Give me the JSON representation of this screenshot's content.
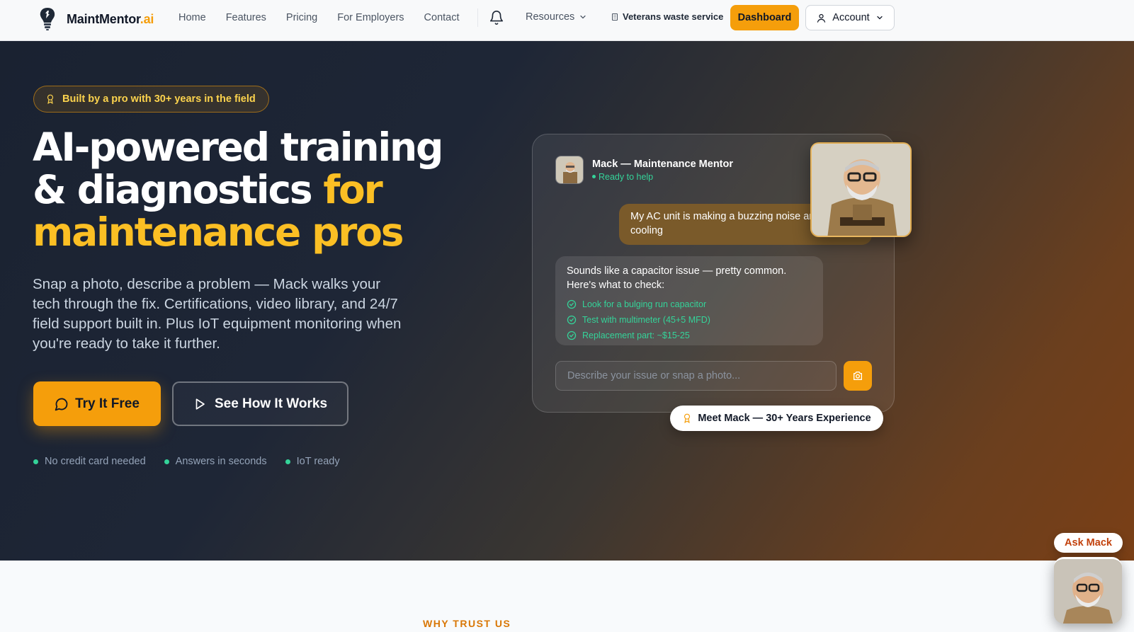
{
  "nav": {
    "brand_main": "MaintMentor",
    "brand_accent": ".ai",
    "links": [
      "Home",
      "Features",
      "Pricing",
      "For Employers",
      "Contact"
    ],
    "notification_icon": "bell-icon",
    "resources_label": "Resources",
    "veterans_label": "Veterans waste service",
    "dashboard_label": "Dashboard",
    "account_label": "Account"
  },
  "hero": {
    "badge": "Built by a pro with 30+ years in the field",
    "title_white_1": "AI-powered training",
    "title_white_2": "& diagnostics ",
    "title_gold_1": "for",
    "title_gold_2": "maintenance pros",
    "lede": "Snap a photo, describe a problem — Mack walks your tech through the fix. Certifications, video library, and 24/7 field support built in. Plus IoT equipment monitoring when you're ready to take it further.",
    "cta_primary": "Try It Free",
    "cta_secondary": "See How It Works",
    "perks": [
      "No credit card needed",
      "Answers in seconds",
      "IoT ready"
    ]
  },
  "chat": {
    "mentor_name": "Mack — Maintenance Mentor",
    "status": "Ready to help",
    "user_message": "My AC unit is making a buzzing noise and not cooling",
    "bot_message": "Sounds like a capacitor issue — pretty common. Here's what to check:",
    "checklist": [
      "Look for a bulging run capacitor",
      "Test with multimeter (45+5 MFD)",
      "Replacement part: ~$15-25"
    ],
    "input_placeholder": "Describe your issue or snap a photo...",
    "meet_pill": "Meet Mack — 30+ Years Experience"
  },
  "section": {
    "eyebrow": "WHY TRUST US"
  },
  "widget": {
    "ask_label": "Ask Mack"
  },
  "colors": {
    "accent": "#f59e0b",
    "accent_text": "#fbbf24",
    "success": "#34d399",
    "hero_dark": "#1a2231",
    "hero_warm": "#7a3f16"
  }
}
